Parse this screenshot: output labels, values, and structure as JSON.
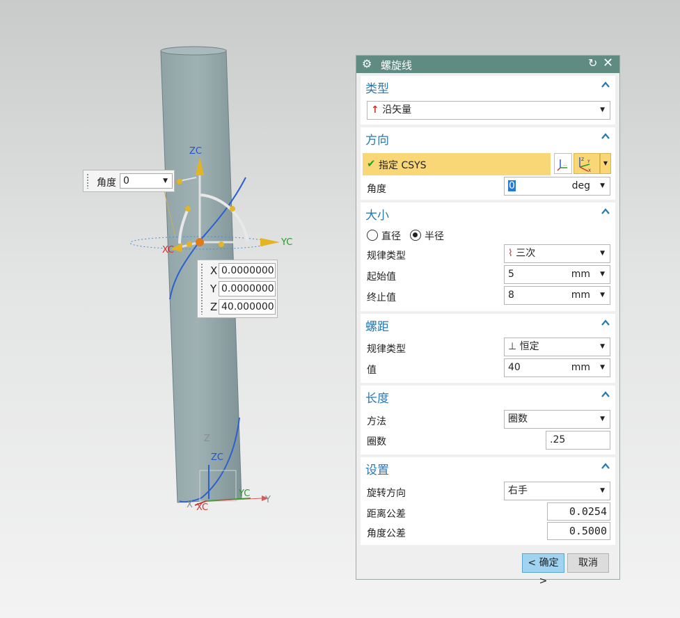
{
  "viewport": {
    "triad_labels": {
      "zc": "ZC",
      "yc": "YC",
      "xc": "XC"
    },
    "small_triad_labels": {
      "z": "Z",
      "zc": "ZC",
      "yc": "YC",
      "y": "Y",
      "x": "X",
      "xc": "XC"
    },
    "angle_popup": {
      "label": "角度",
      "value": "0"
    },
    "coord_popup": [
      {
        "key": "X",
        "value": "0.0000000"
      },
      {
        "key": "Y",
        "value": "0.0000000"
      },
      {
        "key": "Z",
        "value": "40.000000"
      }
    ]
  },
  "dialog": {
    "title": "螺旋线",
    "icons": {
      "title": "gear-icon",
      "reset": "reset-icon",
      "close": "close-icon"
    },
    "type_group": {
      "title": "类型",
      "selected": "沿矢量"
    },
    "direction_group": {
      "title": "方向",
      "csys_label": "指定 CSYS",
      "angle_label": "角度",
      "angle_value": "0",
      "angle_unit": "deg"
    },
    "size_group": {
      "title": "大小",
      "radio_diameter": "直径",
      "radio_radius": "半径",
      "selected": "半径",
      "law_type_label": "规律类型",
      "law_type_value": "三次",
      "start_label": "起始值",
      "start_value": "5",
      "start_unit": "mm",
      "end_label": "终止值",
      "end_value": "8",
      "end_unit": "mm"
    },
    "pitch_group": {
      "title": "螺距",
      "law_type_label": "规律类型",
      "law_type_value": "恒定",
      "value_label": "值",
      "value": "40",
      "unit": "mm"
    },
    "length_group": {
      "title": "长度",
      "method_label": "方法",
      "method_value": "圈数",
      "turns_label": "圈数",
      "turns_value": ".25"
    },
    "settings_group": {
      "title": "设置",
      "rotation_label": "旋转方向",
      "rotation_value": "右手",
      "distance_tol_label": "距离公差",
      "distance_tol_value": "0.0254",
      "angle_tol_label": "角度公差",
      "angle_tol_value": "0.5000"
    },
    "buttons": {
      "ok": "< 确定 >",
      "cancel": "取消"
    }
  }
}
